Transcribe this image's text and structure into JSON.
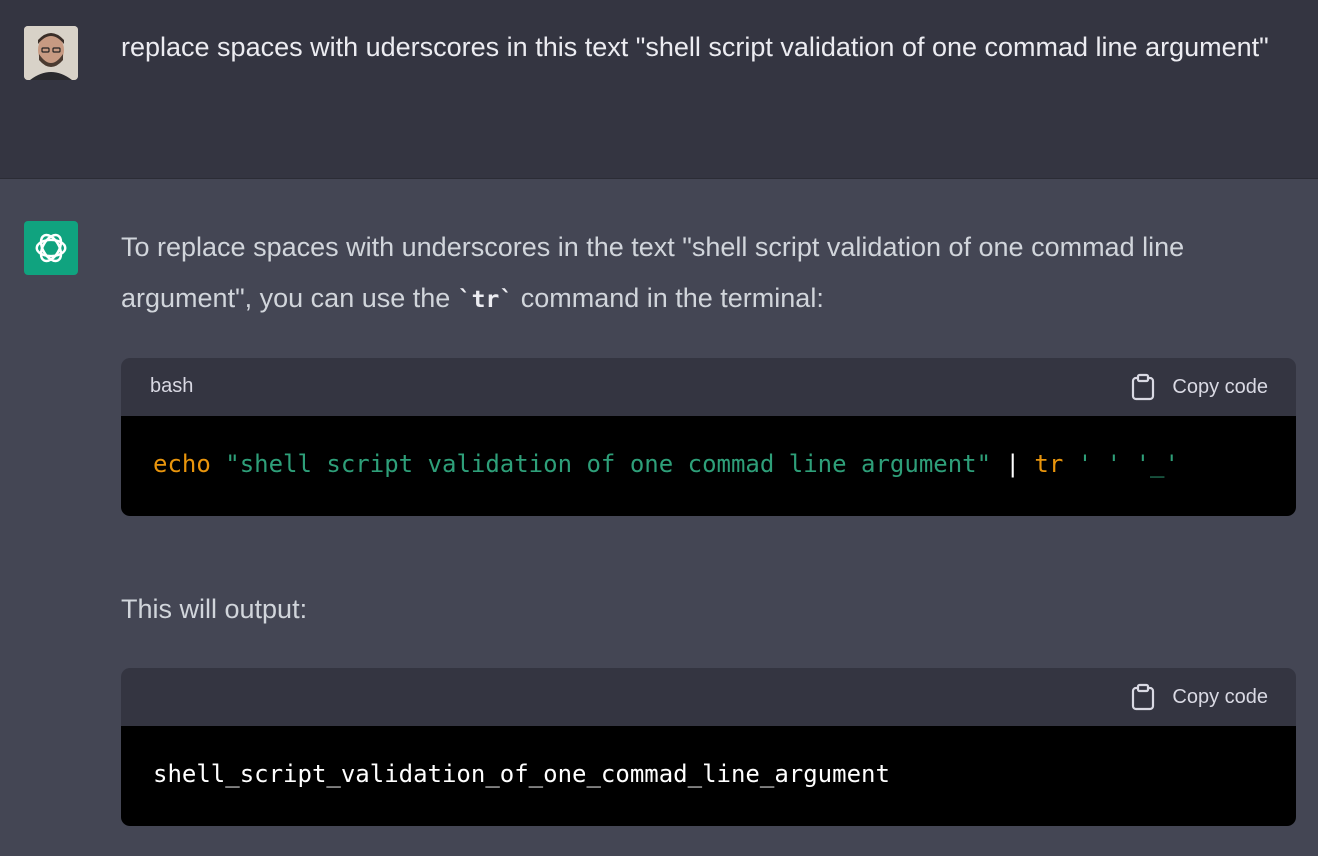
{
  "user_message": {
    "avatar": "user-avatar-photo",
    "text": "replace spaces with uderscores in this text \"shell script validation of one commad line argument\""
  },
  "assistant_message": {
    "avatar": "openai-logo-icon",
    "intro_before": "To replace spaces with underscores in the text \"shell script validation of one commad line argument\", you can use the ",
    "intro_code": "`tr`",
    "intro_after": " command in the terminal:",
    "code_block_1": {
      "language": "bash",
      "copy_label": "Copy code",
      "tokens": {
        "cmd": "echo",
        "sp1": " ",
        "str": "\"shell script validation of one commad line argument\"",
        "pipe": " | ",
        "cmd2": "tr",
        "args": " ' ' '_'"
      }
    },
    "output_intro": "This will output:",
    "code_block_2": {
      "language": "",
      "copy_label": "Copy code",
      "line": "shell_script_validation_of_one_commad_line_argument"
    }
  },
  "colors": {
    "user_bg": "#343541",
    "assistant_bg": "#444654",
    "bot_avatar": "#10a37f",
    "code_bg": "#000000",
    "code_header_bg": "#343541",
    "keyword": "#e9950c",
    "string": "#2e9f79"
  }
}
